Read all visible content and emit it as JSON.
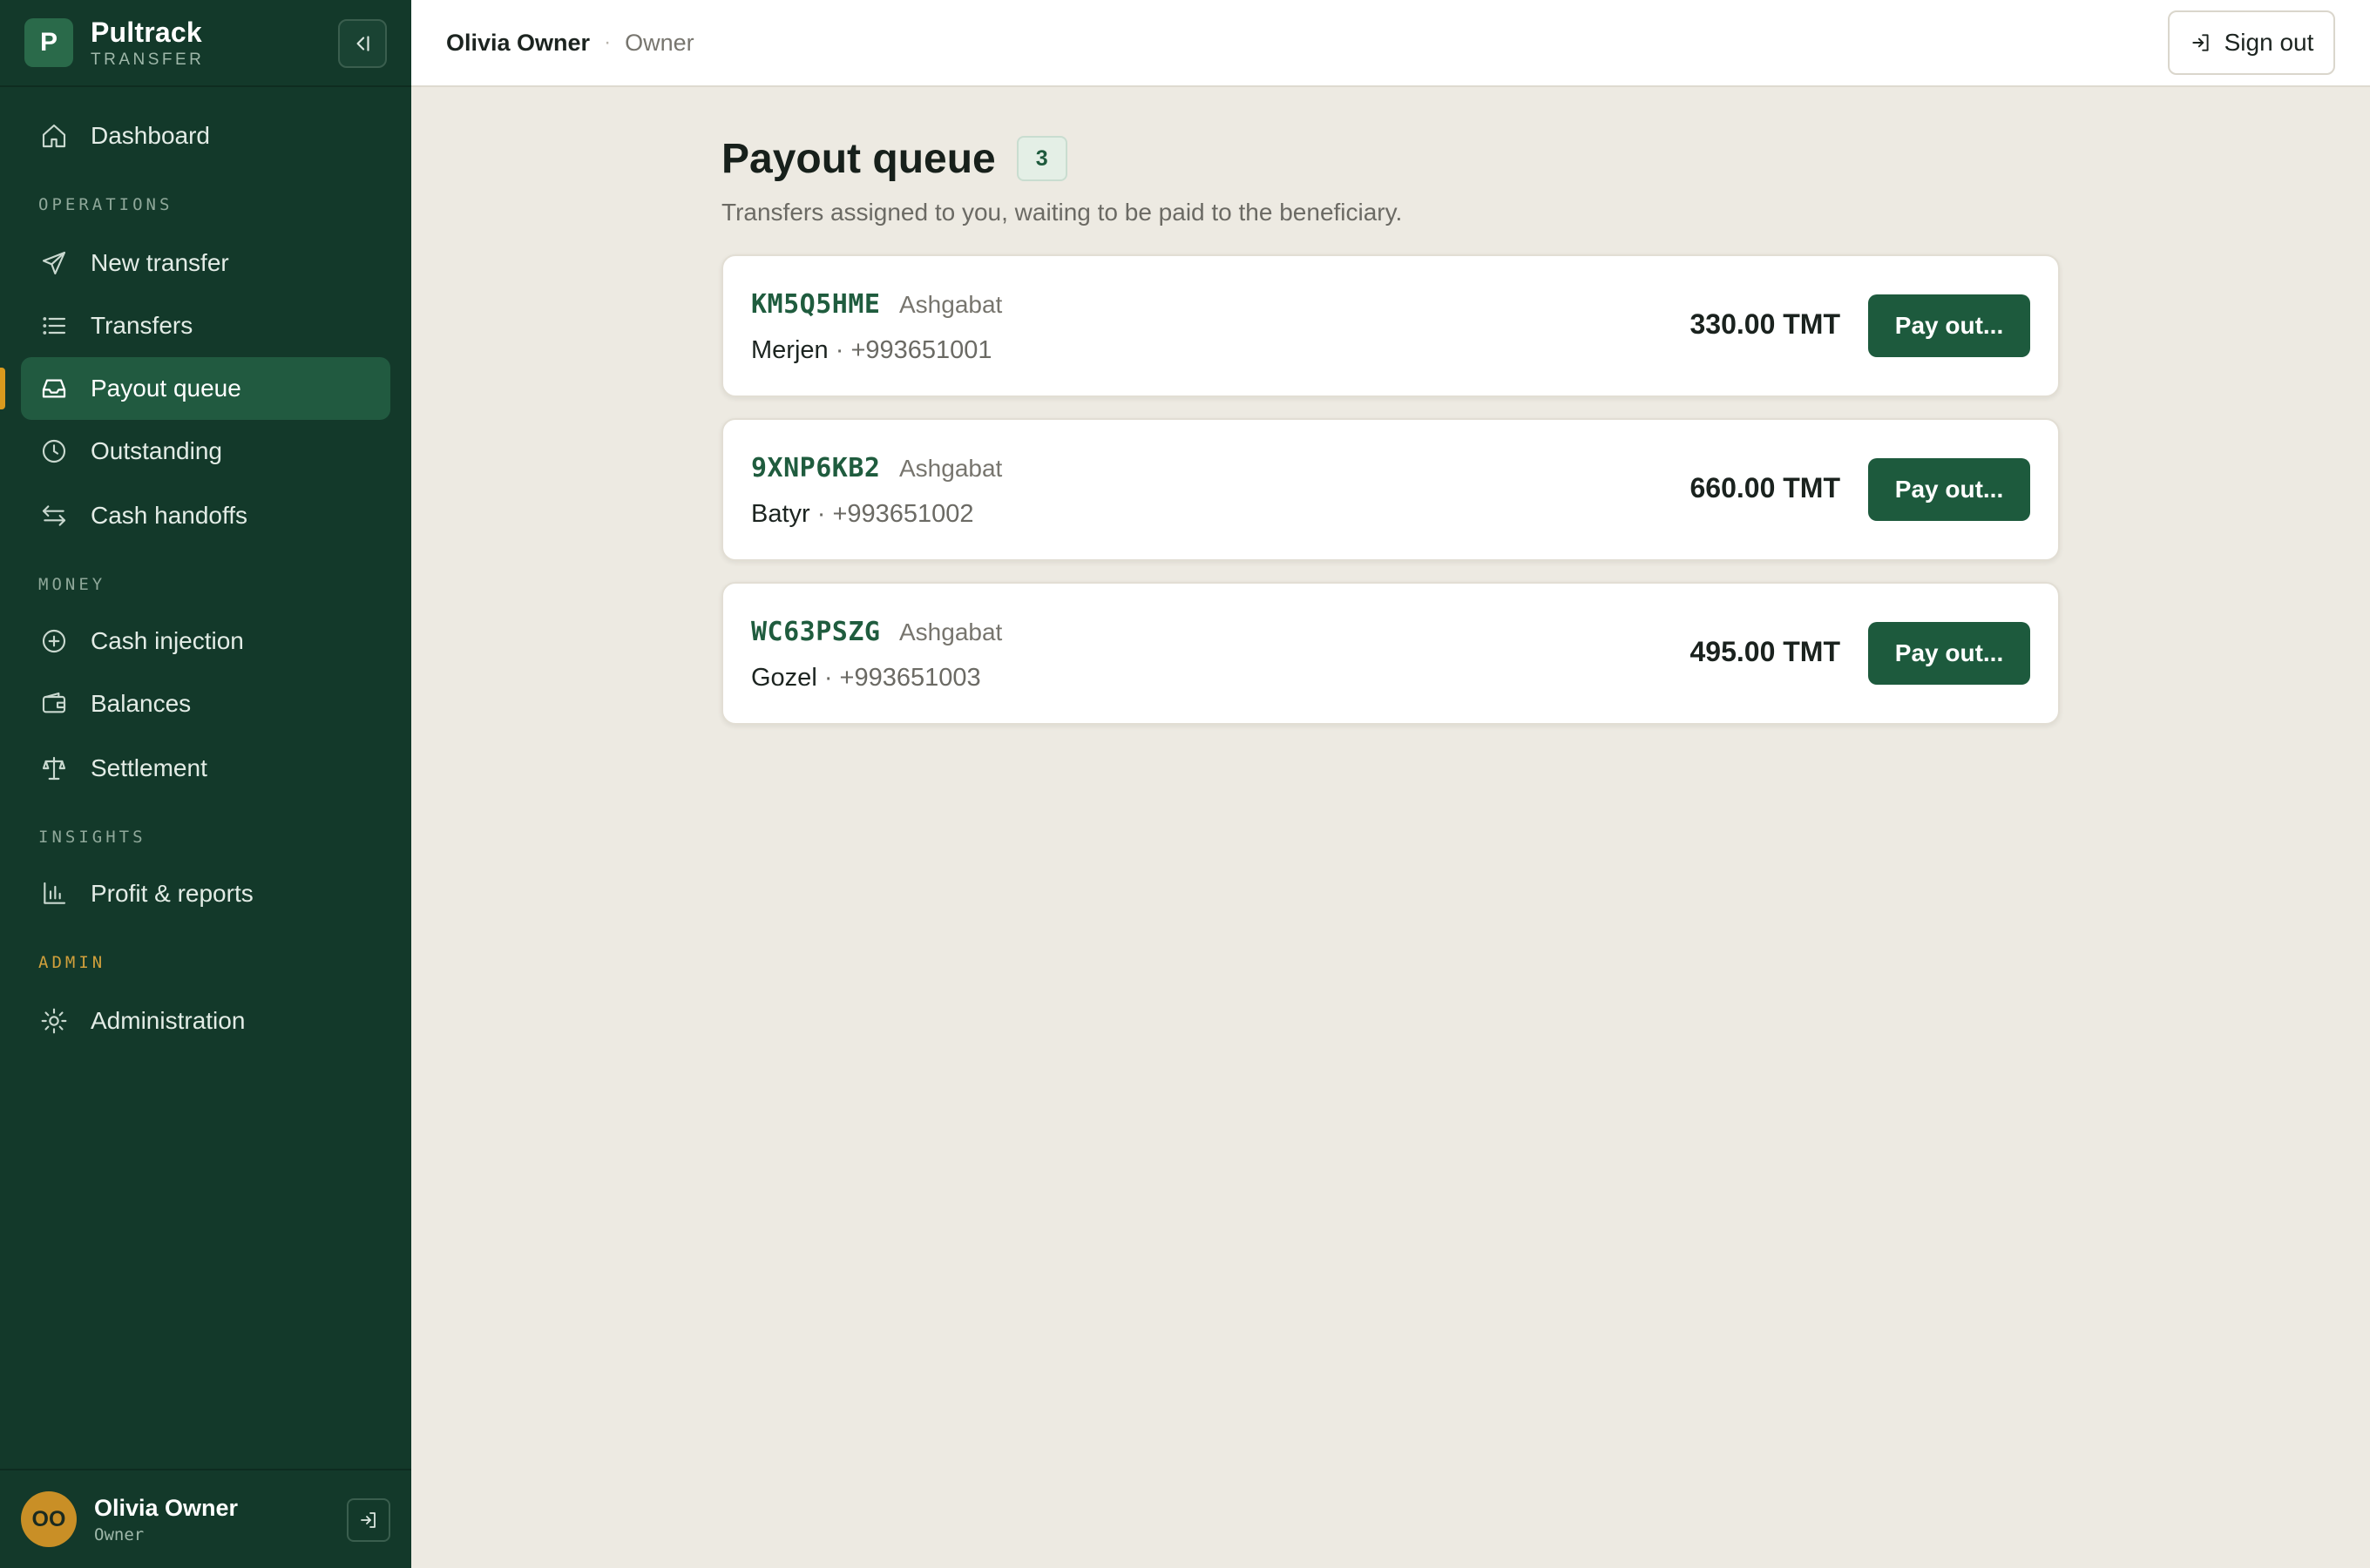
{
  "brand": {
    "logo_letter": "P",
    "name": "Pultrack",
    "subtitle": "TRANSFER"
  },
  "sidebar": {
    "collapse_icon": "collapse-left-icon",
    "dashboard": "Dashboard",
    "sections": {
      "operations": "OPERATIONS",
      "money": "MONEY",
      "insights": "INSIGHTS",
      "admin": "ADMIN"
    },
    "items": [
      {
        "label": "New transfer",
        "icon": "send-icon"
      },
      {
        "label": "Transfers",
        "icon": "list-icon"
      },
      {
        "label": "Payout queue",
        "icon": "inbox-icon",
        "active": true
      },
      {
        "label": "Outstanding",
        "icon": "clock-icon"
      },
      {
        "label": "Cash handoffs",
        "icon": "swap-arrows-icon"
      },
      {
        "label": "Cash injection",
        "icon": "plus-circle-icon"
      },
      {
        "label": "Balances",
        "icon": "wallet-icon"
      },
      {
        "label": "Settlement",
        "icon": "scale-icon"
      },
      {
        "label": "Profit & reports",
        "icon": "bar-chart-icon"
      },
      {
        "label": "Administration",
        "icon": "gear-icon"
      }
    ],
    "user": {
      "initials": "OO",
      "name": "Olivia Owner",
      "role": "Owner"
    }
  },
  "topbar": {
    "user_name": "Olivia Owner",
    "separator": "·",
    "role": "Owner",
    "signout_label": "Sign out"
  },
  "main": {
    "title": "Payout queue",
    "count": "3",
    "subtitle": "Transfers assigned to you, waiting to be paid to the beneficiary.",
    "transfers": [
      {
        "code": "KM5Q5HME",
        "city": "Ashgabat",
        "beneficiary": "Merjen",
        "phone": "+993651001",
        "amount": "330.00 TMT",
        "action": "Pay out..."
      },
      {
        "code": "9XNP6KB2",
        "city": "Ashgabat",
        "beneficiary": "Batyr",
        "phone": "+993651002",
        "amount": "660.00 TMT",
        "action": "Pay out..."
      },
      {
        "code": "WC63PSZG",
        "city": "Ashgabat",
        "beneficiary": "Gozel",
        "phone": "+993651003",
        "amount": "495.00 TMT",
        "action": "Pay out..."
      }
    ]
  },
  "colors": {
    "sidebar_bg": "#13392A",
    "active_item": "#215A40",
    "accent": "#D99A1E",
    "primary_button": "#1D5A3D",
    "page_bg": "#EDEAE2"
  }
}
